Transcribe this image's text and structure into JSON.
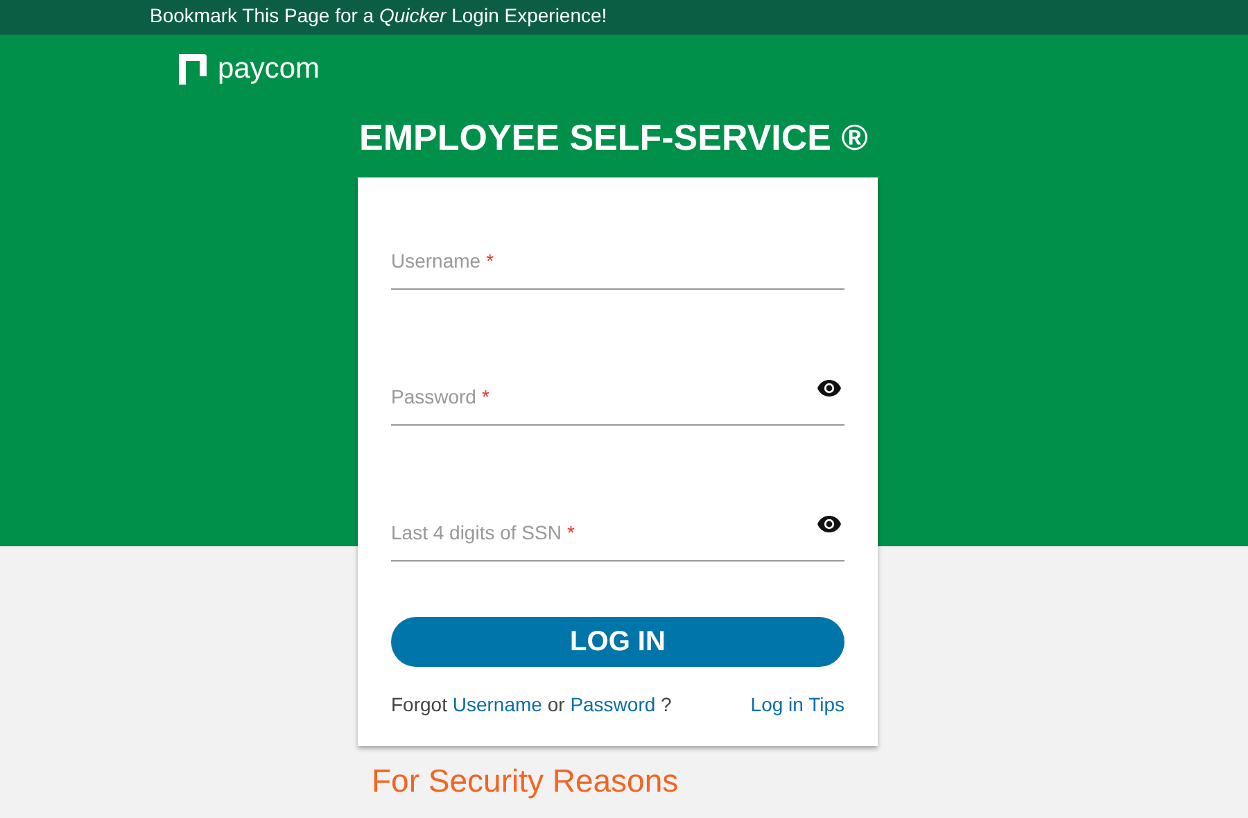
{
  "banner": {
    "text": "Bookmark This Page for a *Quicker* Login Experience!"
  },
  "logo": {
    "text": "paycom"
  },
  "title": "EMPLOYEE SELF-SERVICE ®",
  "fields": [
    {
      "label": "Username",
      "required_mark": "*",
      "reveal_toggle": false
    },
    {
      "label": "Password",
      "required_mark": "*",
      "reveal_toggle": true
    },
    {
      "label": "Last 4 digits of SSN",
      "required_mark": "*",
      "reveal_toggle": true
    }
  ],
  "login_button": "LOG IN",
  "forgot": {
    "prefix": "Forgot",
    "username_link": "Username",
    "middle": "or",
    "password_link": "Password",
    "suffix": "?"
  },
  "tips_link": "Log in Tips",
  "security_heading": "For Security Reasons"
}
